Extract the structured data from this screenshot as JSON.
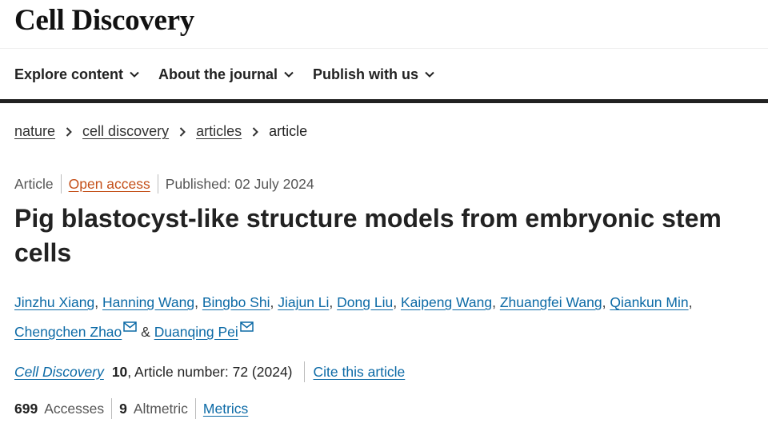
{
  "site": {
    "logo": "Cell Discovery"
  },
  "nav": {
    "items": [
      {
        "label": "Explore content"
      },
      {
        "label": "About the journal"
      },
      {
        "label": "Publish with us"
      }
    ]
  },
  "breadcrumb": {
    "items": [
      {
        "label": "nature"
      },
      {
        "label": "cell discovery"
      },
      {
        "label": "articles"
      }
    ],
    "current": "article"
  },
  "article_meta": {
    "type": "Article",
    "access": "Open access",
    "published": "Published: 02 July 2024"
  },
  "title": "Pig blastocyst-like structure models from embryonic stem cells",
  "authors": {
    "list": [
      {
        "name": "Jinzhu Xiang",
        "sep": ", "
      },
      {
        "name": "Hanning Wang",
        "sep": ", "
      },
      {
        "name": "Bingbo Shi",
        "sep": ", "
      },
      {
        "name": "Jiajun Li",
        "sep": ", "
      },
      {
        "name": "Dong Liu",
        "sep": ", "
      },
      {
        "name": "Kaipeng Wang",
        "sep": ", "
      },
      {
        "name": "Zhuangfei Wang",
        "sep": ", "
      },
      {
        "name": "Qiankun Min",
        "sep": ", "
      },
      {
        "name": "Chengchen Zhao",
        "sep": " & "
      },
      {
        "name": "Duanqing Pei",
        "sep": ""
      }
    ]
  },
  "citation": {
    "journal": "Cell Discovery",
    "volume": "10",
    "article_number": ", Article number: 72 (2024)",
    "cite_label": "Cite this article"
  },
  "metrics": {
    "accesses_count": "699",
    "accesses_label": "Accesses",
    "altmetric_count": "9",
    "altmetric_label": "Altmetric",
    "metrics_link": "Metrics"
  },
  "colors": {
    "link": "#0c6aa6",
    "open_access": "#c4501a",
    "rule": "#222222"
  }
}
